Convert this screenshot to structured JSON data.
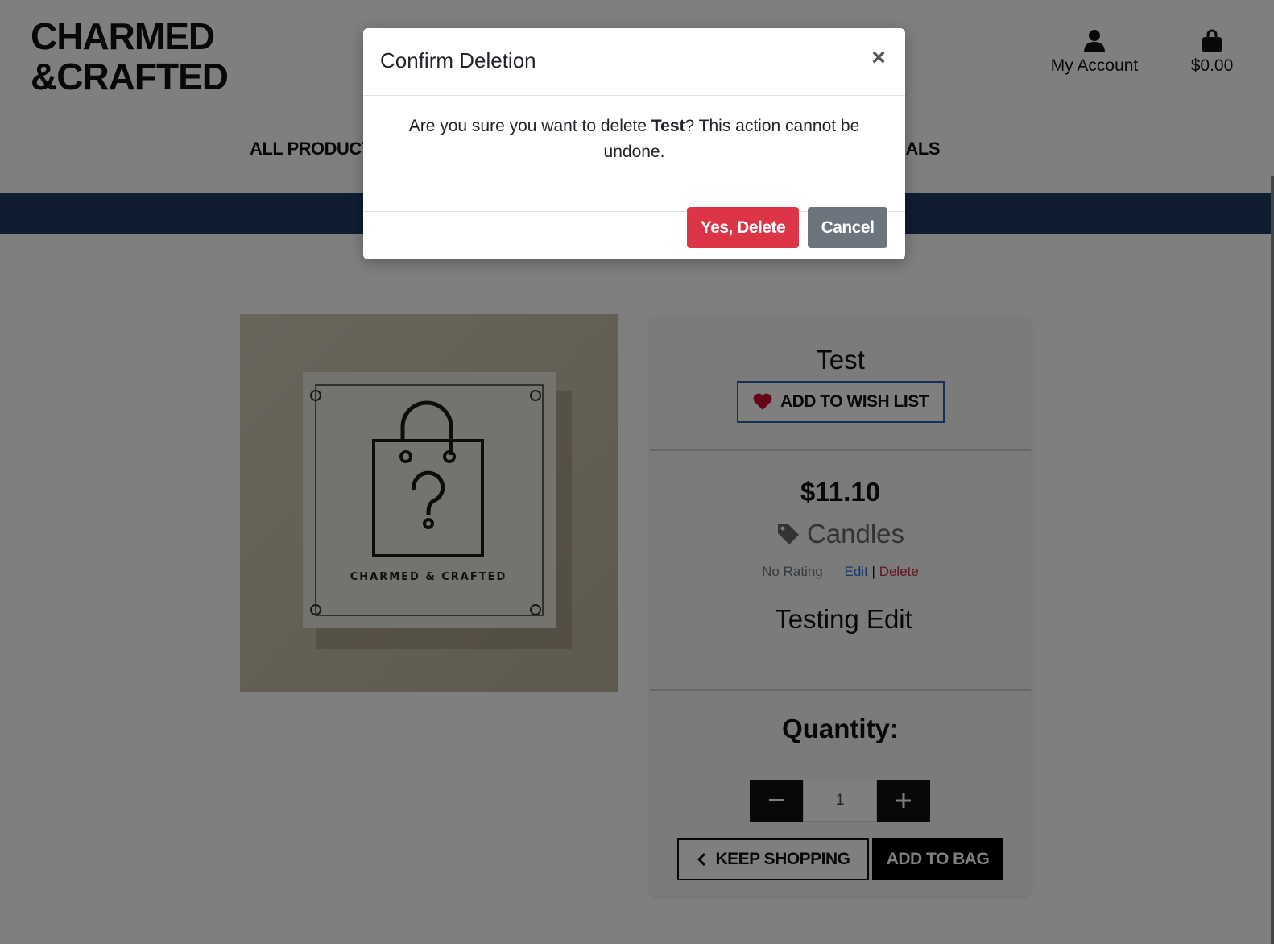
{
  "header": {
    "logo_line1": "CHARMED",
    "logo_line2": "&CRAFTED",
    "account_label": "My Account",
    "bag_total": "$0.00"
  },
  "nav": {
    "all_products": "ALL PRODUCTS",
    "specials": "& SPECIALS"
  },
  "product": {
    "title": "Test",
    "wishlist_label": "ADD TO WISH LIST",
    "price": "$11.10",
    "category": "Candles",
    "rating": "No Rating",
    "edit_label": "Edit",
    "separator": "|",
    "delete_label": "Delete",
    "description": "Testing Edit",
    "image_brand_text": "CHARMED & CRAFTED",
    "quantity_label": "Quantity:",
    "quantity_value": "1",
    "keep_shopping_label": "KEEP SHOPPING",
    "add_to_bag_label": "ADD TO BAG"
  },
  "modal": {
    "title": "Confirm Deletion",
    "close_glyph": "×",
    "message_before": "Are you sure you want to delete ",
    "product_name": "Test",
    "message_after": "? This action cannot be undone.",
    "confirm_label": "Yes, Delete",
    "cancel_label": "Cancel"
  },
  "colors": {
    "banner": "#1f3a63",
    "danger": "#dc3545",
    "secondary": "#6c757d",
    "wishlist_border": "#2f5fae",
    "heart": "#c8102e"
  }
}
